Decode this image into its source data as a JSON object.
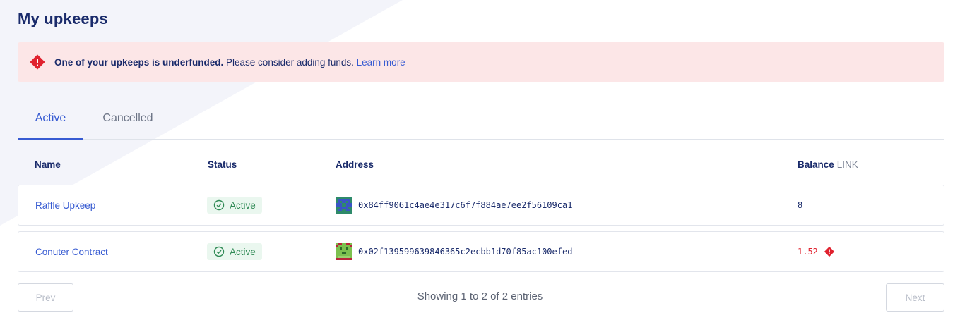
{
  "page": {
    "title": "My upkeeps"
  },
  "alert": {
    "strong": "One of your upkeeps is underfunded.",
    "text": " Please consider adding funds. ",
    "link": "Learn more",
    "color": "#fce6e7"
  },
  "tabs": [
    {
      "label": "Active",
      "selected": true
    },
    {
      "label": "Cancelled",
      "selected": false
    }
  ],
  "table": {
    "headers": {
      "name": "Name",
      "status": "Status",
      "address": "Address",
      "balance": "Balance",
      "balance_unit": "LINK"
    },
    "rows": [
      {
        "name": "Raffle Upkeep",
        "status": "Active",
        "address": "0x84ff9061c4ae4e317c6f7f884ae7ee2f56109ca1",
        "balance": "8",
        "underfunded": false
      },
      {
        "name": "Conuter Contract",
        "status": "Active",
        "address": "0x02f139599639846365c2ecbb1d70f85ac100efed",
        "balance": "1.52",
        "underfunded": true
      }
    ]
  },
  "pagination": {
    "prev": "Prev",
    "next": "Next",
    "summary": "Showing 1 to 2 of 2 entries"
  },
  "colors": {
    "accent": "#375bd2",
    "title": "#1a2b6b",
    "success": "#2f8a55",
    "danger": "#e0212e"
  }
}
